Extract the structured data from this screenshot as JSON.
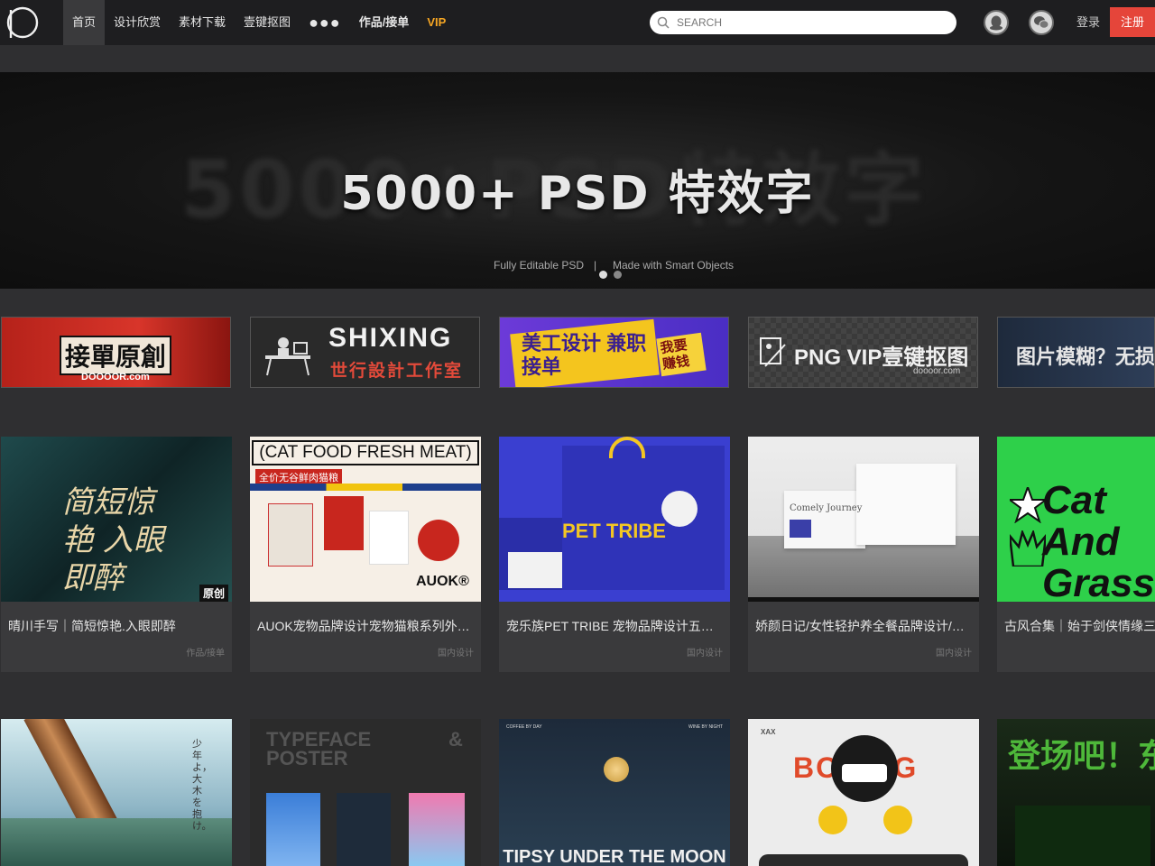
{
  "nav": {
    "items": [
      {
        "label": "首页",
        "active": true
      },
      {
        "label": "设计欣赏"
      },
      {
        "label": "素材下载"
      },
      {
        "label": "壹键抠图"
      },
      {
        "label": "●●●"
      },
      {
        "label": "作品/接单"
      },
      {
        "label": "VIP"
      }
    ],
    "search_placeholder": "SEARCH",
    "login": "登录",
    "register": "注册"
  },
  "banner": {
    "bg_text": "5000+PSD特效字",
    "title": "5000+ PSD 特效字",
    "sub_left": "Fully Editable PSD",
    "separator": "|",
    "sub_right": "Made with Smart Objects"
  },
  "promos": [
    {
      "text": "接單原創",
      "sub": "DOOOOR.com"
    },
    {
      "text": "SHIXING",
      "sub": "世行設計工作室"
    },
    {
      "text": "美工设计 兼职接单",
      "sub": "我要赚钱"
    },
    {
      "text": "PNG VIP壹键抠图",
      "sub": "doooor.com"
    },
    {
      "text": "图片模糊？无损"
    }
  ],
  "cards": [
    {
      "title": "晴川手写｜简短惊艳.入眼即醉",
      "tag": "作品/接单",
      "badge": "原创",
      "art": "简短惊艳 入眼即醉"
    },
    {
      "title": "AUOK宠物品牌设计宠物猫粮系列外…",
      "tag": "国内设计",
      "art": "(CAT FOOD FRESH MEAT)",
      "art2": "全价无谷鲜肉猫粮",
      "art3": "AUOK®"
    },
    {
      "title": "宠乐族PET TRIBE 宠物品牌设计五…",
      "tag": "国内设计",
      "art": "PET TRIBE"
    },
    {
      "title": "娇颜日记/女性轻护养全餐品牌设计/…",
      "tag": "国内设计",
      "art": "Comely Journey"
    },
    {
      "title": "古风合集｜始于剑侠情缘三",
      "tag": "",
      "art": "Cat And Grass"
    }
  ],
  "tiles": [
    {
      "art": "少年よ，大木を抱け。"
    },
    {
      "art": "TYPEFACE POSTER",
      "art2": "&"
    },
    {
      "art": "TIPSY UNDER THE MOON",
      "top_left": "COFFEE BY DAY",
      "top_right": "WINE BY NIGHT"
    },
    {
      "art": "BOXING",
      "logo": "XAX"
    },
    {
      "art": "登场吧！东"
    }
  ]
}
